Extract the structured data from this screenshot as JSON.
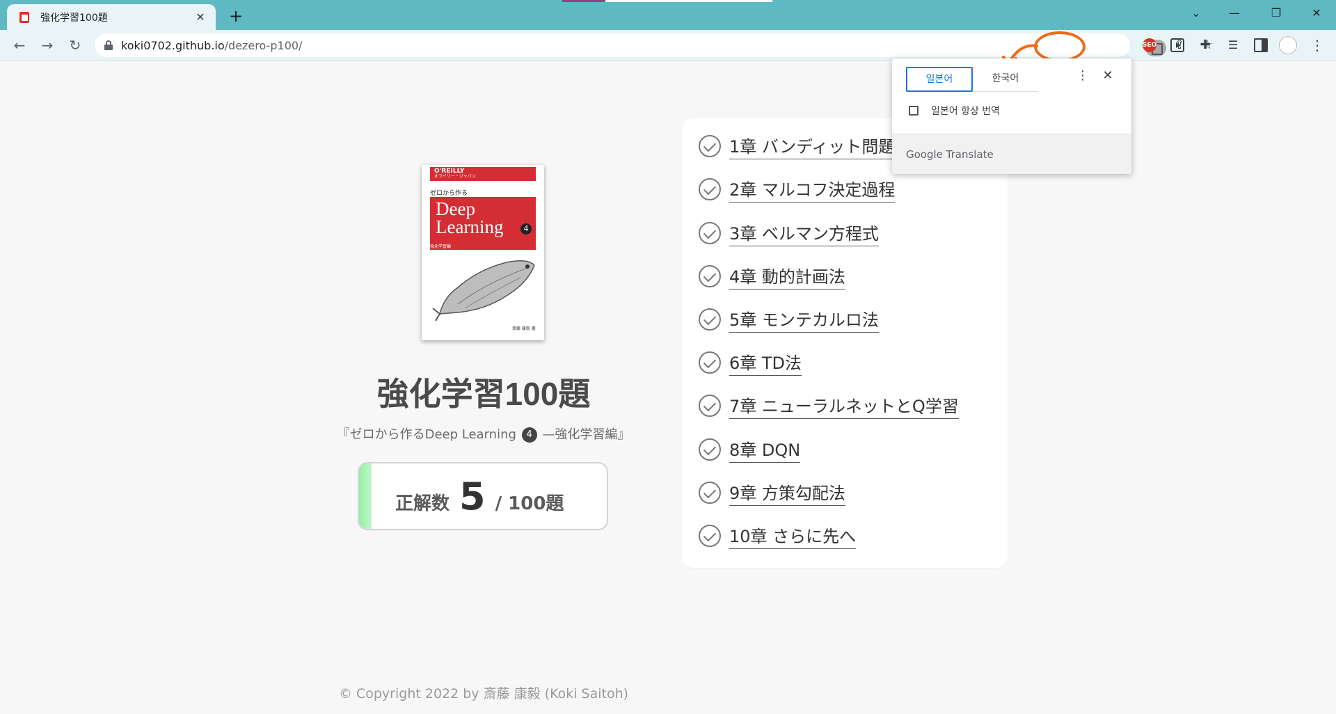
{
  "browser": {
    "tab_title": "強化学習100題",
    "new_tab": "+",
    "url_host": "koki0702.github.io",
    "url_path": "/dezero-p100/",
    "ext_seo": "SEO"
  },
  "translate_popup": {
    "source_lang": "일본어",
    "target_lang": "한국어",
    "always_translate": "일본어 항상 번역",
    "brand": "Google Translate"
  },
  "book": {
    "publisher": "O'REILLY",
    "publisher_sub": "オライリー・ジャパン",
    "subtitle": "ゼロから作る",
    "title_line1": "Deep",
    "title_line2": "Learning",
    "volume": "4",
    "tag": "強化学習編",
    "author": "斎藤 康毅 著"
  },
  "main": {
    "title": "強化学習100題",
    "subtitle_before": "『ゼロから作るDeep Learning",
    "subtitle_num": "4",
    "subtitle_after": "—強化学習編』",
    "score_label": "正解数",
    "score_value": 5,
    "score_total": "/ 100題"
  },
  "chapters": [
    "1章 バンディット問題",
    "2章 マルコフ決定過程",
    "3章 ベルマン方程式",
    "4章 動的計画法",
    "5章 モンテカルロ法",
    "6章 TD法",
    "7章 ニューラルネットとQ学習",
    "8章 DQN",
    "9章 方策勾配法",
    "10章 さらに先へ"
  ],
  "footer": "© Copyright 2022 by 斎藤 康毅 (Koki Saitoh)",
  "colors": {
    "tabbar": "#5fb9c3",
    "annotation": "#f06a1a",
    "accent_blue": "#1a73e8",
    "score_bar": "#8ff0a0"
  }
}
